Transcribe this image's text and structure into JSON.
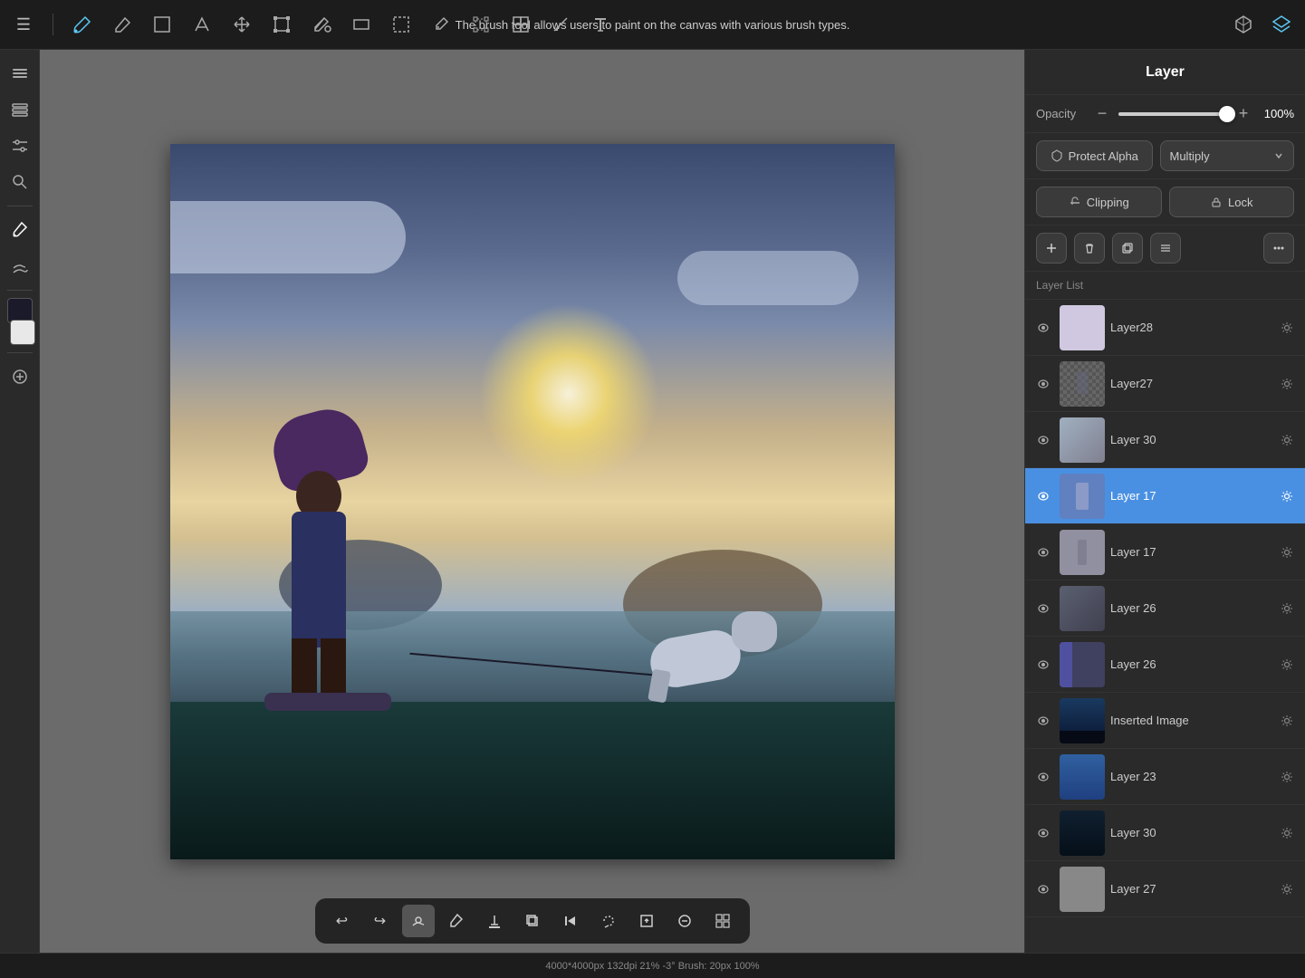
{
  "app": {
    "title": "The brush tool allows users to paint on the canvas with various brush types."
  },
  "toolbar": {
    "menu_icon": "☰",
    "tools": [
      {
        "name": "brush",
        "icon": "✏️",
        "label": "Brush"
      },
      {
        "name": "eraser",
        "icon": "⬡",
        "label": "Eraser"
      },
      {
        "name": "selection-rect",
        "icon": "□",
        "label": "Selection Rectangle"
      },
      {
        "name": "selection-free",
        "icon": "∿",
        "label": "Selection Free"
      },
      {
        "name": "move",
        "icon": "✛",
        "label": "Move"
      },
      {
        "name": "transform",
        "icon": "⊡",
        "label": "Transform"
      },
      {
        "name": "color-fill",
        "icon": "▣",
        "label": "Color Fill"
      },
      {
        "name": "shape",
        "icon": "▭",
        "label": "Shape"
      },
      {
        "name": "marquee",
        "icon": "⬚",
        "label": "Marquee"
      },
      {
        "name": "eyedropper",
        "icon": "⊹",
        "label": "Eyedropper"
      },
      {
        "name": "warp",
        "icon": "⬡",
        "label": "Warp"
      },
      {
        "name": "lasso",
        "icon": "⟳",
        "label": "Lasso"
      },
      {
        "name": "reference",
        "icon": "⊞",
        "label": "Reference"
      },
      {
        "name": "snip",
        "icon": "⊿",
        "label": "Snip"
      },
      {
        "name": "text",
        "icon": "T",
        "label": "Text"
      }
    ],
    "right": [
      {
        "name": "3d-icon",
        "icon": "⬡"
      },
      {
        "name": "layers-icon",
        "icon": "◧"
      }
    ]
  },
  "left_sidebar": {
    "tools": [
      {
        "name": "menu",
        "icon": "≡"
      },
      {
        "name": "layers",
        "icon": "⊟"
      },
      {
        "name": "adjustments",
        "icon": "≡"
      },
      {
        "name": "search",
        "icon": "◎"
      },
      {
        "name": "stroke",
        "icon": "✒"
      },
      {
        "name": "paint-bucket",
        "icon": "✦"
      },
      {
        "name": "color-picker",
        "icon": "●"
      }
    ],
    "colors": [
      {
        "name": "foreground-color",
        "value": "#1a1a2a"
      },
      {
        "name": "background-color",
        "value": "#2a2a3a"
      }
    ]
  },
  "layer_panel": {
    "title": "Layer",
    "opacity": {
      "label": "Opacity",
      "value": "100%",
      "slider_pct": 100
    },
    "protect_alpha": {
      "label": "Protect Alpha"
    },
    "blend_mode": {
      "label": "Multiply"
    },
    "clipping": {
      "label": "Clipping"
    },
    "lock": {
      "label": "Lock"
    },
    "layer_list_title": "Layer List",
    "layers": [
      {
        "id": "layer28",
        "name": "Layer28",
        "visible": true,
        "active": false,
        "thumb_class": "thumb-layer28"
      },
      {
        "id": "layer27",
        "name": "Layer27",
        "visible": true,
        "active": false,
        "thumb_class": "transparent"
      },
      {
        "id": "layer30",
        "name": "Layer 30",
        "visible": true,
        "active": false,
        "thumb_class": "thumb-layer30"
      },
      {
        "id": "layer17-active",
        "name": "Layer 17",
        "visible": true,
        "active": true,
        "thumb_class": "thumb-layer17-active"
      },
      {
        "id": "layer17-2",
        "name": "Layer 17",
        "visible": true,
        "active": false,
        "thumb_class": "thumb-layer17-2"
      },
      {
        "id": "layer26-1",
        "name": "Layer 26",
        "visible": true,
        "active": false,
        "thumb_class": "thumb-layer26-1"
      },
      {
        "id": "layer26-2",
        "name": "Layer 26",
        "visible": true,
        "active": false,
        "thumb_class": "thumb-layer26-2"
      },
      {
        "id": "inserted-image",
        "name": "Inserted Image",
        "visible": true,
        "active": false,
        "thumb_class": "thumb-inserted"
      },
      {
        "id": "layer23",
        "name": "Layer 23",
        "visible": true,
        "active": false,
        "thumb_class": "thumb-layer23"
      },
      {
        "id": "layer30-2",
        "name": "Layer 30",
        "visible": true,
        "active": false,
        "thumb_class": "thumb-layer30-2"
      },
      {
        "id": "layer27-3",
        "name": "Layer 27",
        "visible": true,
        "active": false,
        "thumb_class": "thumb-layer27-3"
      }
    ]
  },
  "status_bar": {
    "text": "4000*4000px 132dpi 21% -3° Brush: 20px 100%"
  },
  "bottom_toolbar": {
    "tools": [
      {
        "name": "undo",
        "icon": "↩"
      },
      {
        "name": "redo",
        "icon": "↪"
      },
      {
        "name": "smudge",
        "icon": "✦"
      },
      {
        "name": "paint",
        "icon": "✏"
      },
      {
        "name": "fill",
        "icon": "⬇"
      },
      {
        "name": "copy",
        "icon": "⧉"
      },
      {
        "name": "skip-back",
        "icon": "⏮"
      },
      {
        "name": "lasso-select",
        "icon": "⟳"
      },
      {
        "name": "export",
        "icon": "⊡"
      },
      {
        "name": "adjustments",
        "icon": "◧"
      },
      {
        "name": "grid",
        "icon": "⊞"
      }
    ]
  }
}
